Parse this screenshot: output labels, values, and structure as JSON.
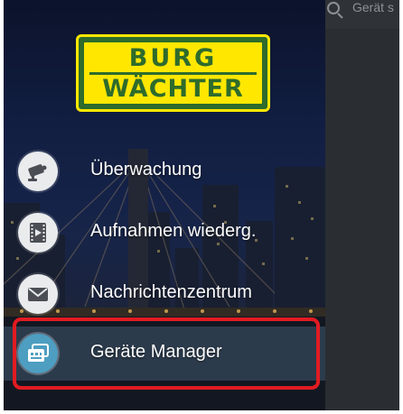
{
  "search": {
    "placeholder": "Gerät s"
  },
  "brand": {
    "line1": "BURG",
    "line2": "WÄCHTER",
    "colors": {
      "green": "#2e6b2c",
      "yellow": "#ffe700"
    }
  },
  "menu": {
    "items": [
      {
        "label": "Überwachung",
        "icon": "camera-icon"
      },
      {
        "label": "Aufnahmen wiederg.",
        "icon": "video-playback-icon"
      },
      {
        "label": "Nachrichtenzentrum",
        "icon": "envelope-icon"
      },
      {
        "label": "Geräte Manager",
        "icon": "device-manager-icon",
        "selected": true
      }
    ]
  },
  "annotation": {
    "highlight_color": "#e11b22",
    "highlighted_item": "Geräte Manager"
  }
}
